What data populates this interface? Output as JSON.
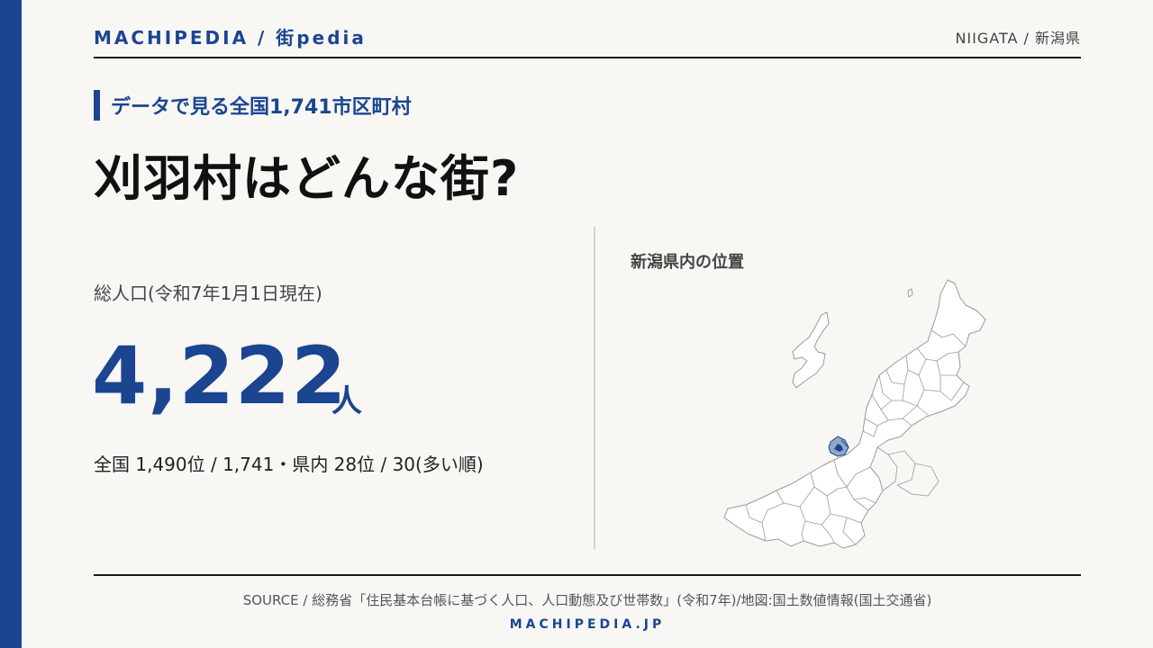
{
  "header": {
    "brand": "MACHIPEDIA / 街pedia",
    "region": "NIIGATA / 新潟県"
  },
  "subtitle": "データで見る全国1,741市区町村",
  "title": "刈羽村はどんな街?",
  "population": {
    "label": "総人口(令和7年1月1日現在)",
    "value": "4,222",
    "unit": "人",
    "rank": "全国 1,490位 / 1,741・県内 28位 / 30(多い順)"
  },
  "map": {
    "title": "新潟県内の位置",
    "highlight_color": "#1b4591",
    "base_color": "#ffffff"
  },
  "footer": {
    "source": "SOURCE / 総務省「住民基本台帳に基づく人口、人口動態及び世帯数」(令和7年)/地図:国土数値情報(国土交通省)",
    "domain": "MACHIPEDIA.JP"
  },
  "colors": {
    "accent": "#1b4591",
    "background": "#f8f7f4"
  }
}
